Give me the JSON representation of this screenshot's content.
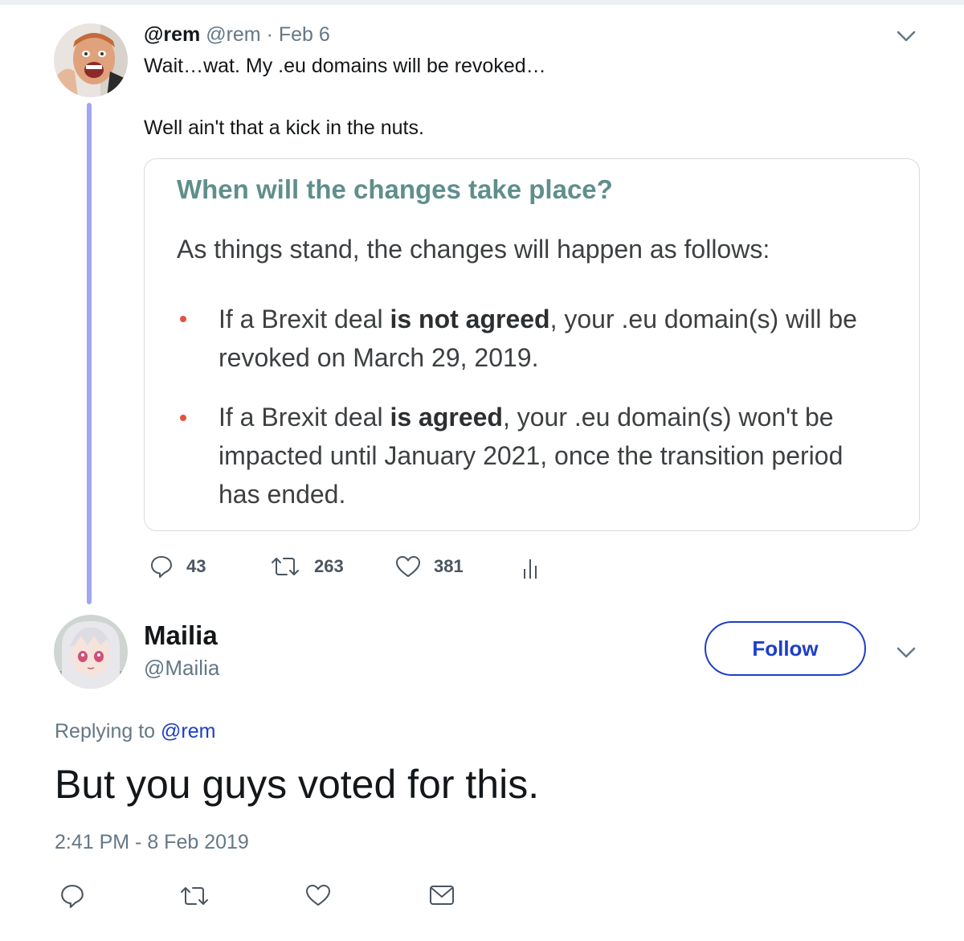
{
  "original_tweet": {
    "display_name": "@rem",
    "handle": "@rem",
    "separator": "·",
    "date": "Feb 6",
    "line1": "Wait…wat. My .eu domains will be revoked…",
    "line2": "Well ain't that a kick in the nuts.",
    "card": {
      "title": "When will the changes take place?",
      "intro": "As things stand, the changes will happen as follows:",
      "bullet1": {
        "pre": "If a Brexit deal ",
        "bold": "is not agreed",
        "post": ", your .eu domain(s) will be",
        "line2": "revoked on March 29, 2019."
      },
      "bullet2": {
        "pre": "If a Brexit deal ",
        "bold": "is agreed",
        "post": ", your .eu domain(s) won't be",
        "line2": "impacted until January 2021, once the transition period",
        "line3": "has ended."
      }
    },
    "stats": {
      "replies": "43",
      "retweets": "263",
      "likes": "381"
    }
  },
  "reply_tweet": {
    "display_name": "Mailia",
    "handle": "@Mailia",
    "follow_label": "Follow",
    "replying_prefix": "Replying to",
    "replying_to": "@rem",
    "text": "But you guys voted for this.",
    "timestamp": "2:41 PM - 8 Feb 2019"
  },
  "icons": {
    "reply": "reply-icon",
    "retweet": "retweet-icon",
    "like": "heart-icon",
    "analytics": "analytics-icon",
    "dm": "envelope-icon",
    "menu": "chevron-down-icon"
  },
  "colors": {
    "thread_line": "#a3a6f2",
    "link": "#1d3ec8",
    "card_title": "#5f8f8c",
    "bullet": "#e0543f"
  }
}
